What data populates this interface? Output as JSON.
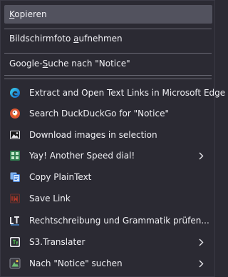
{
  "menu": {
    "items": [
      {
        "label": "Kopieren",
        "access_key": "K",
        "highlighted": true
      },
      {
        "label": "Bildschirmfoto aufnehmen",
        "access_key": "a"
      },
      {
        "label": "Google-Suche nach \"Notice\"",
        "access_key": "S"
      },
      {
        "label": "Extract and Open Text Links in Microsoft Edge",
        "icon": "edge-icon"
      },
      {
        "label": "Search DuckDuckGo for \"Notice\"",
        "icon": "duckduckgo-icon"
      },
      {
        "label": "Download images in selection",
        "icon": "download-images-icon"
      },
      {
        "label": "Yay! Another Speed dial!",
        "icon": "speed-dial-icon",
        "submenu": true
      },
      {
        "label": "Copy PlainText",
        "icon": "copy-plaintext-icon"
      },
      {
        "label": "Save Link",
        "icon": "save-link-icon"
      },
      {
        "label": "Rechtschreibung und Grammatik prüfen...",
        "icon": "languagetool-icon"
      },
      {
        "label": "S3.Translater",
        "icon": "s3-translator-icon",
        "submenu": true
      },
      {
        "label": "Nach \"Notice\" suchen",
        "icon": "search-extension-icon",
        "submenu": true
      }
    ]
  },
  "colors": {
    "background": "#2b2a33",
    "highlight": "#52525e",
    "separator": "#6a6a75",
    "text": "#f0f0f4"
  }
}
